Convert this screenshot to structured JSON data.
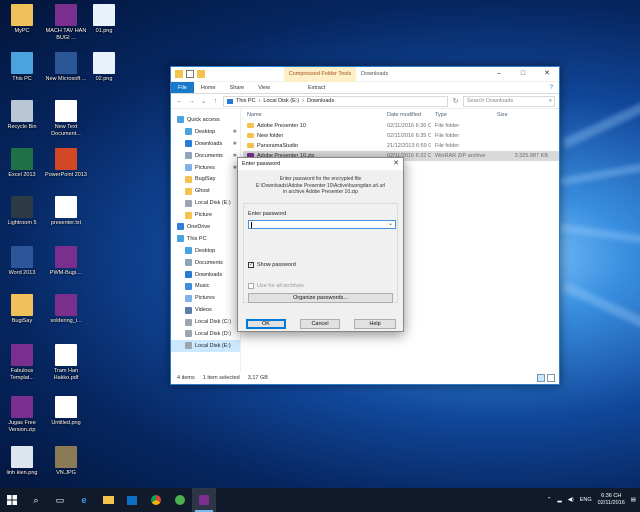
{
  "desktop": {
    "icons": [
      {
        "label": "MyPC",
        "color": "#f0c15a"
      },
      {
        "label": "MACH TAV HAN BUGI ...",
        "color": "#7a2f8e"
      },
      {
        "label": "01.png",
        "color": "#e9f2fb"
      },
      {
        "label": "This PC",
        "color": "#4aa3df"
      },
      {
        "label": "New Microsoft ...",
        "color": "#2b5797"
      },
      {
        "label": "02.png",
        "color": "#e9f2fb"
      },
      {
        "label": "Recycle Bin",
        "color": "#b9c6d6"
      },
      {
        "label": "New Text Document...",
        "color": "#ffffff"
      },
      {
        "label": "Excel 2013",
        "color": "#1e7145"
      },
      {
        "label": "PowerPoint 2013",
        "color": "#d24726"
      },
      {
        "label": "Lightroom 5",
        "color": "#2d3945"
      },
      {
        "label": "presenter.txt",
        "color": "#ffffff"
      },
      {
        "label": "Word 2013",
        "color": "#2b579a"
      },
      {
        "label": "PWM-Bugi....",
        "color": "#7a2f8e"
      },
      {
        "label": "BugiSay",
        "color": "#f0c15a"
      },
      {
        "label": "soldering_i...",
        "color": "#7a2f8e"
      },
      {
        "label": "Fabulous Templat...",
        "color": "#7a2f8e"
      },
      {
        "label": "Tram Han Hakko.pdf",
        "color": "#ffffff"
      },
      {
        "label": "Jugas Free Version.zip",
        "color": "#7a2f8e"
      },
      {
        "label": "Untitled.png",
        "color": "#ffffff"
      },
      {
        "label": "linh kien.png",
        "color": "#dde5ee"
      },
      {
        "label": "VN.JPG",
        "color": "#8a7a55"
      }
    ]
  },
  "explorer": {
    "context_tab": "Compressed Folder Tools",
    "title": "Downloads",
    "ribbon_tabs": [
      "File",
      "Home",
      "Share",
      "View"
    ],
    "extract_tab": "Extract",
    "breadcrumb": [
      "This PC",
      "Local Disk (E:)",
      "Downloads"
    ],
    "search_placeholder": "Search Downloads",
    "sidebar": [
      {
        "label": "Quick access",
        "top": true,
        "color": "#4aa3df"
      },
      {
        "label": "Desktop",
        "color": "#4aa3df",
        "pinned": true
      },
      {
        "label": "Downloads",
        "color": "#2a7bd4",
        "pinned": true
      },
      {
        "label": "Documents",
        "color": "#8ea4bd",
        "pinned": true
      },
      {
        "label": "Pictures",
        "color": "#7fb2e5",
        "pinned": true
      },
      {
        "label": "BugiSay",
        "color": "#f3c350"
      },
      {
        "label": "Ghost",
        "color": "#f3c350"
      },
      {
        "label": "Local Disk (E:)",
        "color": "#9aa5b1"
      },
      {
        "label": "Picture",
        "color": "#f3c350"
      },
      {
        "label": "OneDrive",
        "top": true,
        "color": "#2f7fd6"
      },
      {
        "label": "This PC",
        "top": true,
        "color": "#4aa3df"
      },
      {
        "label": "Desktop",
        "color": "#4aa3df"
      },
      {
        "label": "Documents",
        "color": "#8ea4bd"
      },
      {
        "label": "Downloads",
        "color": "#2a7bd4"
      },
      {
        "label": "Music",
        "color": "#3c8fd8"
      },
      {
        "label": "Pictures",
        "color": "#7fb2e5"
      },
      {
        "label": "Videos",
        "color": "#5d7ea8"
      },
      {
        "label": "Local Disk (C:)",
        "color": "#9aa5b1"
      },
      {
        "label": "Local Disk (D:)",
        "color": "#9aa5b1"
      },
      {
        "label": "Local Disk (E:)",
        "color": "#9aa5b1",
        "selected": true
      }
    ],
    "columns": [
      "Name",
      "Date modified",
      "Type",
      "Size"
    ],
    "files": [
      {
        "name": "Adobe Presenter 10",
        "date": "02/11/2016 6:36 CH",
        "type": "File folder",
        "size": "",
        "kind": "folder"
      },
      {
        "name": "New folder",
        "date": "02/11/2016 6:35 CH",
        "type": "File folder",
        "size": "",
        "kind": "folder"
      },
      {
        "name": "PanoramaStudio",
        "date": "21/12/2013 6:59 CH",
        "type": "File folder",
        "size": "",
        "kind": "folder"
      },
      {
        "name": "Adobe Presenter 10.zip",
        "date": "02/11/2016 6:32 CH",
        "type": "WinRAR ZIP archive",
        "size": "3.325.887 KB",
        "kind": "rar",
        "selected": true
      }
    ],
    "status": {
      "items": "4 items",
      "selected": "1 item selected",
      "size": "3,17 GB"
    }
  },
  "dialog": {
    "title": "Enter password",
    "message_line1": "Enter password for the encrypted file",
    "message_line2": "E:\\Downloads\\Adobe Presenter 10\\Active\\buongdan.url.url",
    "message_line3": "in archive Adobe Presenter 10.zip",
    "password_label": "Enter password",
    "password_value": "",
    "show_password_label": "Show password",
    "show_password_checked": true,
    "use_all_label": "Use for all archives",
    "organize_label": "Organize passwords...",
    "ok_label": "OK",
    "cancel_label": "Cancel",
    "help_label": "Help"
  },
  "taskbar": {
    "language": "ENG",
    "time": "6:36 CH",
    "date": "02/11/2016"
  }
}
